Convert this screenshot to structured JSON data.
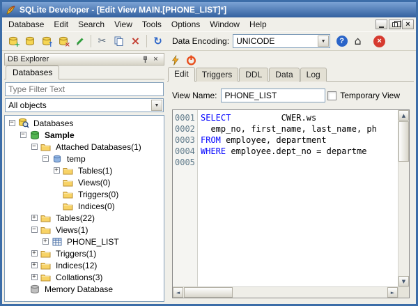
{
  "window": {
    "title": "SQLite Developer - [Edit View MAIN.[PHONE_LIST]*]"
  },
  "colors": {
    "titlebar": "#33609f",
    "keyword": "#0000ff"
  },
  "menu": {
    "items": [
      "Database",
      "Edit",
      "Search",
      "View",
      "Tools",
      "Options",
      "Window",
      "Help"
    ]
  },
  "toolbar": {
    "encoding_label": "Data Encoding:",
    "encoding_value": "UNICODE",
    "left_icons": [
      {
        "name": "new-database-icon",
        "type": "db-new"
      },
      {
        "name": "open-database-icon",
        "type": "db-open"
      },
      {
        "name": "attach-database-icon",
        "type": "db-attach"
      },
      {
        "name": "detach-database-icon",
        "type": "db-detach"
      },
      {
        "name": "edit-icon",
        "type": "pencil"
      },
      {
        "name": "toolbar-separator",
        "type": "sep"
      },
      {
        "name": "cut-icon",
        "type": "cut"
      },
      {
        "name": "copy-icon",
        "type": "copy"
      },
      {
        "name": "delete-icon",
        "type": "delete"
      },
      {
        "name": "toolbar-separator",
        "type": "sep"
      },
      {
        "name": "refresh-icon",
        "type": "refresh"
      }
    ],
    "right_icons": [
      {
        "name": "help-icon",
        "type": "help"
      },
      {
        "name": "home-icon",
        "type": "home"
      },
      {
        "name": "exit-icon",
        "type": "stop"
      }
    ]
  },
  "explorer": {
    "title": "DB Explorer",
    "tab": "Databases",
    "filter_placeholder": "Type Filter Text",
    "object_filter": "All objects",
    "tree": [
      {
        "level": 0,
        "icon": "db-search",
        "label": "Databases",
        "expander": "minus",
        "bold": false
      },
      {
        "level": 1,
        "icon": "db-green",
        "label": "Sample",
        "expander": "minus",
        "bold": true
      },
      {
        "level": 2,
        "icon": "folder",
        "label": "Attached Databases(1)",
        "expander": "minus",
        "bold": false
      },
      {
        "level": 3,
        "icon": "db-blue",
        "label": "temp",
        "expander": "minus",
        "bold": false
      },
      {
        "level": 4,
        "icon": "folder",
        "label": "Tables(1)",
        "expander": "plus",
        "bold": false
      },
      {
        "level": 4,
        "icon": "folder",
        "label": "Views(0)",
        "expander": null,
        "bold": false
      },
      {
        "level": 4,
        "icon": "folder",
        "label": "Triggers(0)",
        "expander": null,
        "bold": false
      },
      {
        "level": 4,
        "icon": "folder",
        "label": "Indices(0)",
        "expander": null,
        "bold": false
      },
      {
        "level": 2,
        "icon": "folder",
        "label": "Tables(22)",
        "expander": "plus",
        "bold": false
      },
      {
        "level": 2,
        "icon": "folder",
        "label": "Views(1)",
        "expander": "minus",
        "bold": false
      },
      {
        "level": 3,
        "icon": "table",
        "label": "PHONE_LIST",
        "expander": "plus",
        "bold": false
      },
      {
        "level": 2,
        "icon": "folder",
        "label": "Triggers(1)",
        "expander": "plus",
        "bold": false
      },
      {
        "level": 2,
        "icon": "folder",
        "label": "Indices(12)",
        "expander": "plus",
        "bold": false
      },
      {
        "level": 2,
        "icon": "folder",
        "label": "Collations(3)",
        "expander": "plus",
        "bold": false
      },
      {
        "level": 1,
        "icon": "db-gray",
        "label": "Memory Database",
        "expander": null,
        "bold": false
      }
    ]
  },
  "editor": {
    "panel_icons": [
      {
        "name": "execute-icon",
        "type": "bolt"
      },
      {
        "name": "power-icon",
        "type": "power"
      }
    ],
    "tabs": [
      "Edit",
      "Triggers",
      "DDL",
      "Data",
      "Log"
    ],
    "active_tab": "Edit",
    "view_name_label": "View Name:",
    "view_name_value": "PHONE_LIST",
    "temporary_view_label": "Temporary View",
    "temporary_view_checked": false,
    "lines": [
      {
        "num": "0001",
        "segments": [
          {
            "text": "SELECT",
            "type": "kw"
          },
          {
            "text": "          CWER.ws",
            "type": "txt"
          }
        ]
      },
      {
        "num": "0002",
        "segments": [
          {
            "text": "  emp_no, first_name, last_name, ph",
            "type": "txt"
          }
        ]
      },
      {
        "num": "0003",
        "segments": [
          {
            "text": "FROM",
            "type": "kw"
          },
          {
            "text": " employee, department",
            "type": "txt"
          }
        ]
      },
      {
        "num": "0004",
        "segments": [
          {
            "text": "WHERE",
            "type": "kw"
          },
          {
            "text": " employee.dept_no = departme",
            "type": "txt"
          }
        ]
      },
      {
        "num": "0005",
        "segments": []
      }
    ]
  }
}
